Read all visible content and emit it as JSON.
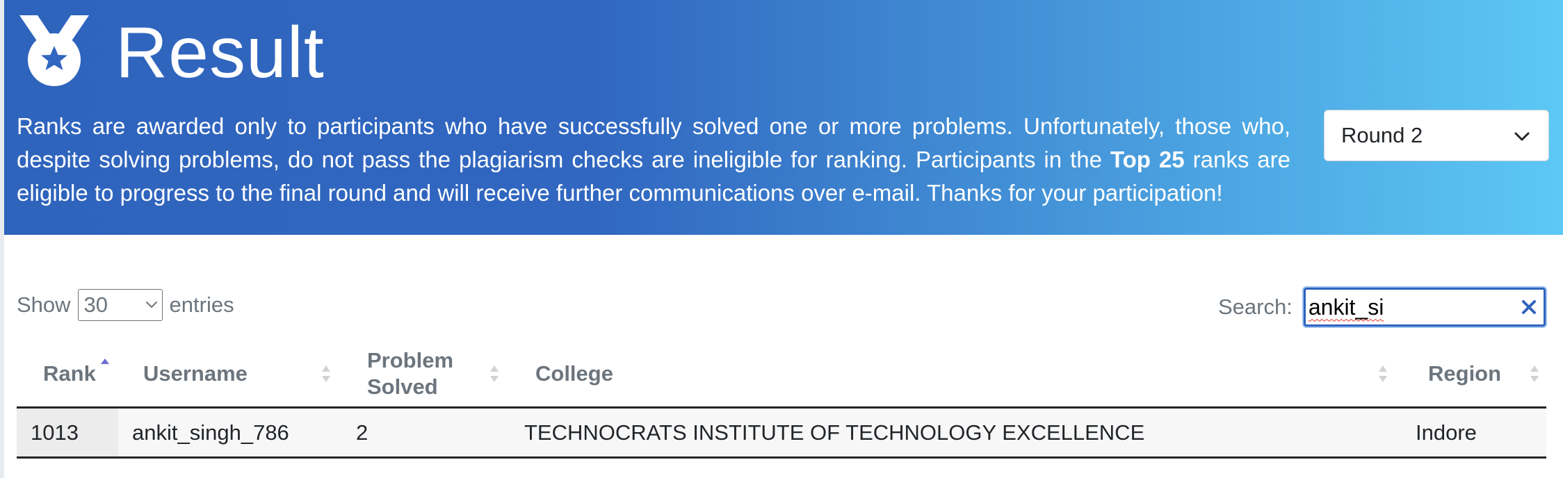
{
  "header": {
    "title": "Result",
    "desc_part1": "Ranks are awarded only to participants who have successfully solved one or more problems. Unfortunately, those who, despite solving problems, do not pass the plagiarism checks are ineligible for ranking. Participants in the ",
    "desc_bold": "Top 25",
    "desc_part2": " ranks are eligible to progress to the final round and will receive further communications over e-mail. Thanks for your participation!",
    "icon": "medal-icon",
    "round_selected": "Round 2"
  },
  "controls": {
    "show_label": "Show",
    "entries_value": "30",
    "entries_label": "entries",
    "search_label": "Search:",
    "search_value": "ankit_si"
  },
  "table": {
    "columns": [
      "Rank",
      "Username",
      "Problem Solved",
      "College",
      "Region"
    ],
    "rows": [
      {
        "rank": "1013",
        "username": "ankit_singh_786",
        "problem_solved": "2",
        "college": "TECHNOCRATS INSTITUTE OF TECHNOLOGY EXCELLENCE",
        "region": "Indore"
      }
    ]
  },
  "colors": {
    "banner_start": "#2f64bd",
    "banner_end": "#5cc8f5",
    "accent": "#2f64bd"
  }
}
